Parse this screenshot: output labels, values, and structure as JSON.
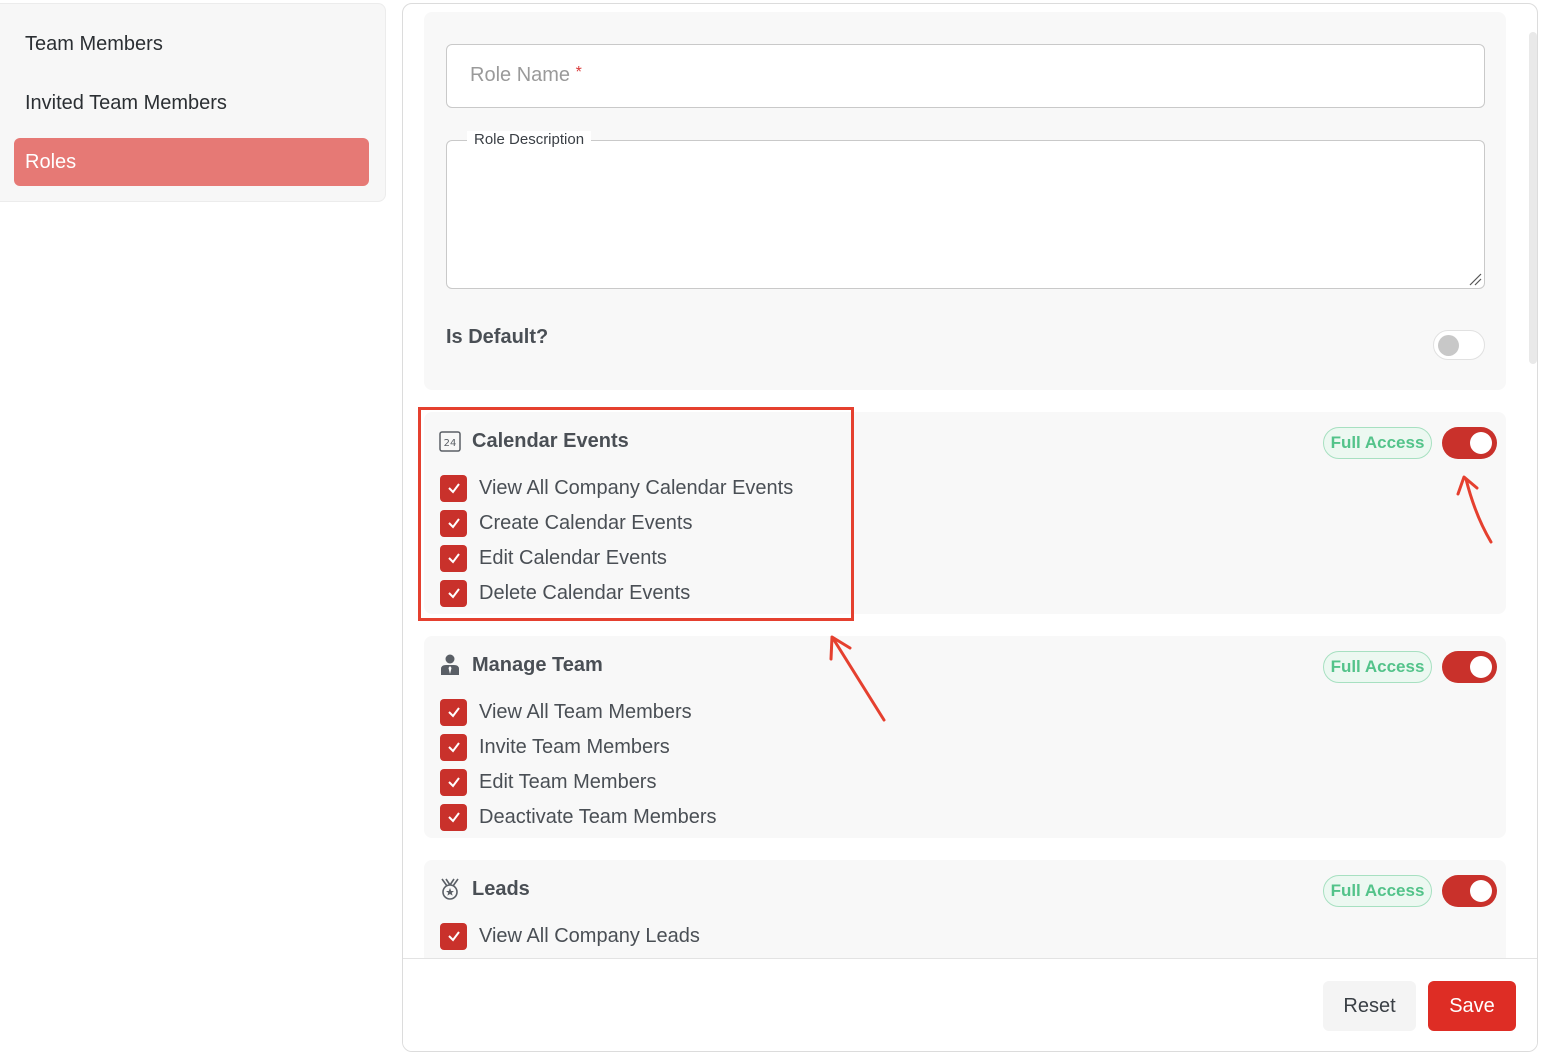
{
  "sidebar": {
    "items": [
      {
        "label": "Team Members",
        "active": false
      },
      {
        "label": "Invited Team Members",
        "active": false
      },
      {
        "label": "Roles",
        "active": true
      }
    ]
  },
  "form": {
    "role_name_placeholder": "Role Name",
    "required_mark": "*",
    "role_description_label": "Role Description",
    "is_default_label": "Is Default?",
    "is_default_value": false
  },
  "permissions": [
    {
      "title": "Calendar Events",
      "icon": "calendar-24-icon",
      "badge": "Full Access",
      "enabled": true,
      "items": [
        "View All Company Calendar Events",
        "Create Calendar Events",
        "Edit Calendar Events",
        "Delete Calendar Events"
      ]
    },
    {
      "title": "Manage Team",
      "icon": "team-member-icon",
      "badge": "Full Access",
      "enabled": true,
      "items": [
        "View All Team Members",
        "Invite Team Members",
        "Edit Team Members",
        "Deactivate Team Members"
      ]
    },
    {
      "title": "Leads",
      "icon": "medal-icon",
      "badge": "Full Access",
      "enabled": true,
      "items": [
        "View All Company Leads"
      ]
    }
  ],
  "footer": {
    "reset_label": "Reset",
    "save_label": "Save"
  },
  "colors": {
    "accent": "#c9312b",
    "sidebar_active": "#e67975",
    "badge_text": "#53c38a",
    "annotation": "#e5402f"
  }
}
